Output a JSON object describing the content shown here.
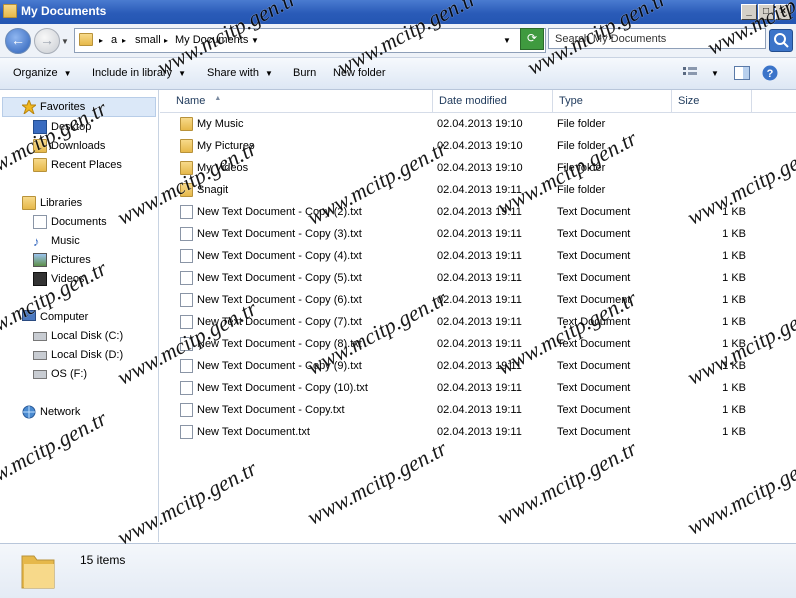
{
  "window": {
    "title": "My Documents"
  },
  "address": {
    "crumbs": [
      "a",
      "small",
      "My Documents"
    ],
    "search_placeholder": "Search My Documents"
  },
  "toolbar": {
    "organize": "Organize",
    "include": "Include in library",
    "share": "Share with",
    "burn": "Burn",
    "new_folder": "New folder"
  },
  "nav": {
    "favorites": "Favorites",
    "desktop": "Desktop",
    "downloads": "Downloads",
    "recent": "Recent Places",
    "libraries": "Libraries",
    "documents": "Documents",
    "music": "Music",
    "pictures": "Pictures",
    "videos": "Videos",
    "computer": "Computer",
    "disk_c": "Local Disk (C:)",
    "disk_d": "Local Disk (D:)",
    "os_f": "OS (F:)",
    "network": "Network"
  },
  "columns": {
    "name": "Name",
    "date": "Date modified",
    "type": "Type",
    "size": "Size"
  },
  "files": [
    {
      "name": "My Music",
      "date": "02.04.2013 19:10",
      "type": "File folder",
      "size": "",
      "kind": "folder"
    },
    {
      "name": "My Pictures",
      "date": "02.04.2013 19:10",
      "type": "File folder",
      "size": "",
      "kind": "folder"
    },
    {
      "name": "My Videos",
      "date": "02.04.2013 19:10",
      "type": "File folder",
      "size": "",
      "kind": "folder"
    },
    {
      "name": "Snagit",
      "date": "02.04.2013 19:11",
      "type": "File folder",
      "size": "",
      "kind": "folder"
    },
    {
      "name": "New Text Document - Copy (2).txt",
      "date": "02.04.2013 19:11",
      "type": "Text Document",
      "size": "1 KB",
      "kind": "doc"
    },
    {
      "name": "New Text Document - Copy (3).txt",
      "date": "02.04.2013 19:11",
      "type": "Text Document",
      "size": "1 KB",
      "kind": "doc"
    },
    {
      "name": "New Text Document - Copy (4).txt",
      "date": "02.04.2013 19:11",
      "type": "Text Document",
      "size": "1 KB",
      "kind": "doc"
    },
    {
      "name": "New Text Document - Copy (5).txt",
      "date": "02.04.2013 19:11",
      "type": "Text Document",
      "size": "1 KB",
      "kind": "doc"
    },
    {
      "name": "New Text Document - Copy (6).txt",
      "date": "02.04.2013 19:11",
      "type": "Text Document",
      "size": "1 KB",
      "kind": "doc"
    },
    {
      "name": "New Text Document - Copy (7).txt",
      "date": "02.04.2013 19:11",
      "type": "Text Document",
      "size": "1 KB",
      "kind": "doc"
    },
    {
      "name": "New Text Document - Copy (8).txt",
      "date": "02.04.2013 19:11",
      "type": "Text Document",
      "size": "1 KB",
      "kind": "doc"
    },
    {
      "name": "New Text Document - Copy (9).txt",
      "date": "02.04.2013 19:11",
      "type": "Text Document",
      "size": "1 KB",
      "kind": "doc"
    },
    {
      "name": "New Text Document - Copy (10).txt",
      "date": "02.04.2013 19:11",
      "type": "Text Document",
      "size": "1 KB",
      "kind": "doc"
    },
    {
      "name": "New Text Document - Copy.txt",
      "date": "02.04.2013 19:11",
      "type": "Text Document",
      "size": "1 KB",
      "kind": "doc"
    },
    {
      "name": "New Text Document.txt",
      "date": "02.04.2013 19:11",
      "type": "Text Document",
      "size": "1 KB",
      "kind": "doc"
    }
  ],
  "status": {
    "count": "15 items"
  },
  "watermark": "www.mcitp.gen.tr"
}
